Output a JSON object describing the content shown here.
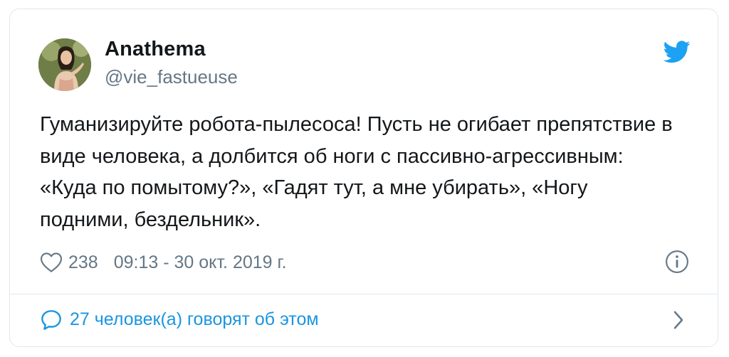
{
  "author": {
    "name": "Anathema",
    "handle": "@vie_fastueuse"
  },
  "tweet": {
    "text": "Гуманизируйте робота-пылесоса! Пусть не огибает препятствие в виде человека, а долбится об ноги с пассивно-агрессивным: «Куда по помытому?», «Гадят тут, а мне убирать», «Ногу подними, бездельник».",
    "likes": "238",
    "timestamp": "09:13 - 30 окт. 2019 г."
  },
  "conversation": {
    "label": "27 человек(а) говорят об этом"
  },
  "icons": {
    "brand": "twitter-bird-icon",
    "like": "heart-icon",
    "info": "info-icon",
    "reply": "speech-bubble-icon",
    "open": "chevron-right-icon"
  },
  "colors": {
    "twitter_blue": "#1da1f2",
    "link_blue": "#1b95e0",
    "text": "#14171a",
    "muted": "#657786",
    "border": "#e1e8ed"
  }
}
